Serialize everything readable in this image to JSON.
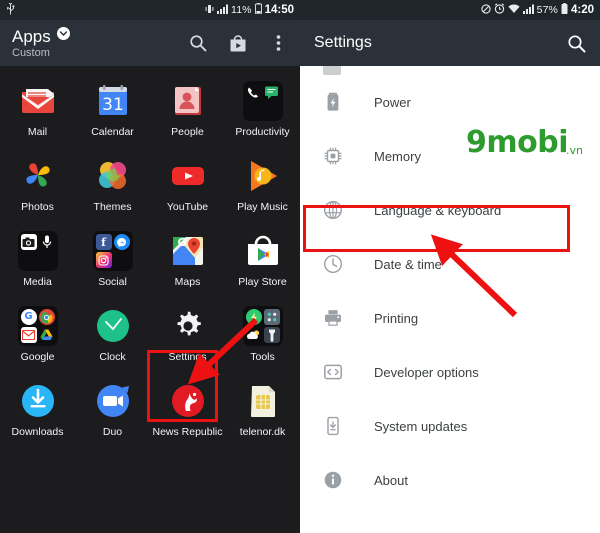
{
  "left_panel": {
    "statusbar": {
      "icons_left": [
        "usb-icon"
      ],
      "icons_right": [
        "vibrate-icon",
        "signal-icon",
        "battery-icon"
      ],
      "battery": "11%",
      "time": "14:50"
    },
    "header": {
      "title": "Apps",
      "subtitle": "Custom",
      "dropdown_icon": "chevron-down-circle-icon",
      "actions": [
        "search-icon",
        "play-store-icon",
        "overflow-menu-icon"
      ]
    },
    "apps": [
      {
        "label": "Mail",
        "icon": "mail-icon"
      },
      {
        "label": "Calendar",
        "icon": "calendar-icon",
        "badge": "31"
      },
      {
        "label": "People",
        "icon": "people-icon"
      },
      {
        "label": "Productivity",
        "icon": "productivity-folder-icon"
      },
      {
        "label": "Photos",
        "icon": "photos-icon"
      },
      {
        "label": "Themes",
        "icon": "themes-icon"
      },
      {
        "label": "YouTube",
        "icon": "youtube-icon"
      },
      {
        "label": "Play Music",
        "icon": "play-music-icon"
      },
      {
        "label": "Media",
        "icon": "media-folder-icon"
      },
      {
        "label": "Social",
        "icon": "social-folder-icon"
      },
      {
        "label": "Maps",
        "icon": "maps-icon"
      },
      {
        "label": "Play Store",
        "icon": "play-store-icon"
      },
      {
        "label": "Google",
        "icon": "google-folder-icon"
      },
      {
        "label": "Clock",
        "icon": "clock-icon"
      },
      {
        "label": "Settings",
        "icon": "settings-gear-icon"
      },
      {
        "label": "Tools",
        "icon": "tools-folder-icon"
      },
      {
        "label": "Downloads",
        "icon": "downloads-icon"
      },
      {
        "label": "Duo",
        "icon": "duo-icon"
      },
      {
        "label": "News Republic",
        "icon": "news-republic-icon"
      },
      {
        "label": "telenor.dk",
        "icon": "sim-card-icon"
      }
    ]
  },
  "right_panel": {
    "statusbar": {
      "icons_right": [
        "mute-icon",
        "alarm-icon",
        "wifi-icon",
        "signal-icon",
        "battery-icon"
      ],
      "battery": "57%",
      "time": "4:20"
    },
    "header": {
      "title": "Settings",
      "search_icon": "search-icon"
    },
    "settings_items": [
      {
        "label": "Power",
        "icon": "battery-icon"
      },
      {
        "label": "Memory",
        "icon": "memory-chip-icon"
      },
      {
        "label": "Language & keyboard",
        "icon": "globe-icon",
        "highlighted": true
      },
      {
        "label": "Date & time",
        "icon": "clock-icon"
      },
      {
        "label": "Printing",
        "icon": "printer-icon"
      },
      {
        "label": "Developer options",
        "icon": "code-brackets-icon"
      },
      {
        "label": "System updates",
        "icon": "phone-download-icon"
      },
      {
        "label": "About",
        "icon": "info-icon"
      }
    ],
    "watermark": {
      "text": "9mobi",
      "suffix": ".vn",
      "color": "#2e9b2e"
    }
  },
  "annotations": {
    "highlight_color": "#ee1111",
    "boxes": [
      {
        "target": "Settings",
        "panel": "left"
      },
      {
        "target": "Language & keyboard",
        "panel": "right"
      }
    ],
    "arrows": [
      {
        "from": "Play Store area",
        "to": "Settings"
      },
      {
        "from": "below Date & time",
        "to": "Language & keyboard"
      }
    ]
  }
}
